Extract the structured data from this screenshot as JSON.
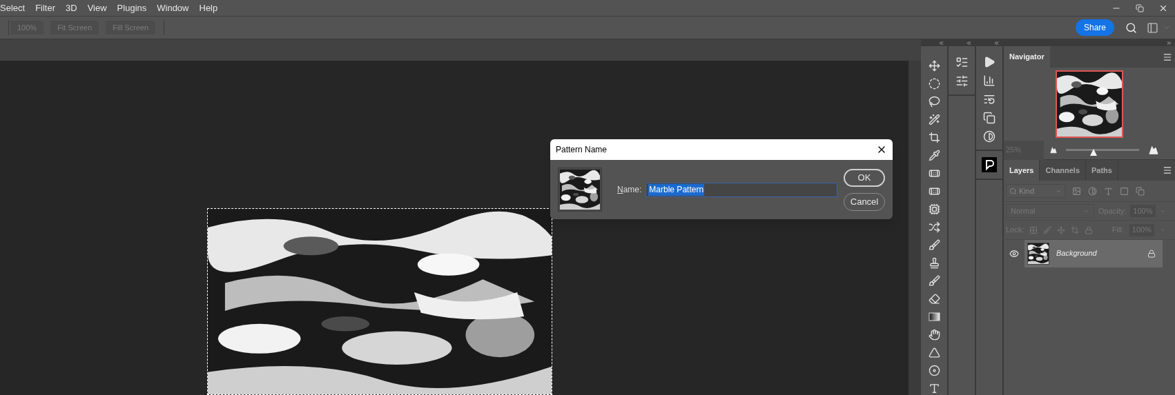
{
  "menu": [
    "Select",
    "Filter",
    "3D",
    "View",
    "Plugins",
    "Window",
    "Help"
  ],
  "options_bar": {
    "buttons": [
      {
        "label": "100%",
        "disabled": true
      },
      {
        "label": "Fit Screen",
        "disabled": true
      },
      {
        "label": "Fill Screen",
        "disabled": true
      }
    ],
    "share": "Share"
  },
  "dialog": {
    "title": "Pattern Name",
    "name_label": "Name:",
    "name_value": {
      "text": "Marble Pattern",
      "selected": true
    },
    "buttons": [
      {
        "label": "OK",
        "default": true
      },
      {
        "label": "Cancel",
        "default": false
      }
    ]
  },
  "navigator": {
    "title": "Navigator",
    "zoom": "25%",
    "level": 0.38
  },
  "layers_panel": {
    "tabs": [
      {
        "label": "Layers",
        "selected": true
      },
      {
        "label": "Channels",
        "selected": false
      },
      {
        "label": "Paths",
        "selected": false
      }
    ],
    "filter": "Kind",
    "blend_mode": "Normal",
    "opacity_label": "Opacity:",
    "opacity": "100%",
    "lock_label": "Lock:",
    "fill_label": "Fill:",
    "fill": "100%",
    "layers": [
      {
        "name": "Background",
        "visible": true,
        "locked": true,
        "selected": true
      }
    ]
  }
}
